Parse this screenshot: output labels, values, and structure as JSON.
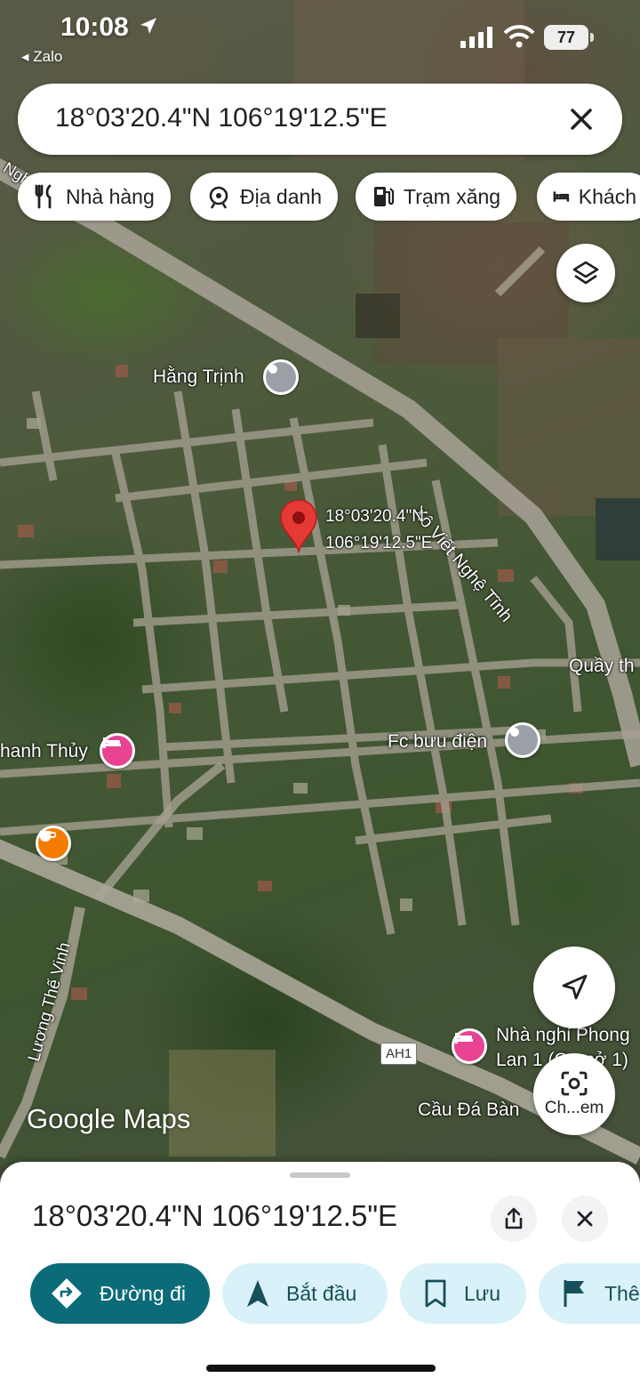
{
  "status_bar": {
    "time": "10:08",
    "back_app": "Zalo",
    "battery": "77"
  },
  "search": {
    "query": "18°03'20.4\"N 106°19'12.5\"E"
  },
  "chips": [
    {
      "label": "Nhà hàng",
      "icon": "restaurant-icon"
    },
    {
      "label": "Địa danh",
      "icon": "landmark-icon"
    },
    {
      "label": "Trạm xăng",
      "icon": "gas-station-icon"
    },
    {
      "label": "Khách",
      "icon": "hotel-icon"
    }
  ],
  "map": {
    "pin_label_line1": "18°03'20.4\"N",
    "pin_label_line2": "106°19'12.5\"E",
    "labels": {
      "hang_trinh": "Hằng Trịnh",
      "xo_viet": "Xô Viết Nghệ Tĩnh",
      "xo_viet_short": "Nghệ",
      "quay": "Quầy th",
      "fc_buu_dien": "Fc bưu điện",
      "thanh_thuy": "hanh Thủy",
      "luong_the_vinh": "Lương Thế Vinh",
      "nha_nghi_1": "Nhà nghỉ Phong",
      "nha_nghi_2": "Lan 1 (Cơ sở 1)",
      "cau_da_ban": "Cầu Đá Bàn",
      "highway": "AH1"
    },
    "attribution": "Google Maps",
    "camera_label": "Ch...em"
  },
  "sheet": {
    "coordinates": "18°03'20.4\"N 106°19'12.5\"E",
    "actions": [
      {
        "label": "Đường đi",
        "icon": "directions-icon"
      },
      {
        "label": "Bắt đầu",
        "icon": "navigate-icon"
      },
      {
        "label": "Lưu",
        "icon": "bookmark-icon"
      },
      {
        "label": "Thê",
        "icon": "flag-icon"
      }
    ]
  },
  "colors": {
    "primary": "#0b6b78",
    "secondary": "#d9f1f8",
    "pin": "#e53935",
    "hotel_poi": "#e84393",
    "cafe_poi": "#f57c00",
    "place_poi": "#9aa0a6"
  }
}
